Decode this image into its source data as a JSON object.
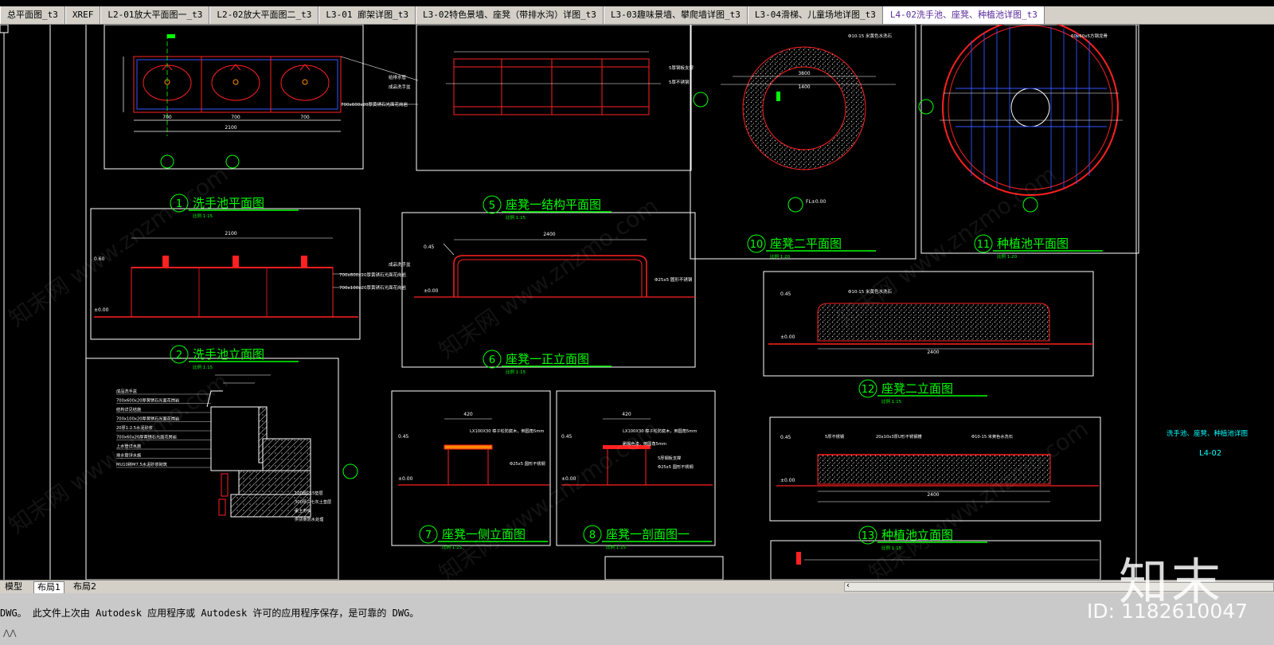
{
  "tabs": [
    {
      "label": "总平面图_t3",
      "active": false
    },
    {
      "label": "XREF",
      "active": false
    },
    {
      "label": "L2-01放大平面图一_t3",
      "active": false
    },
    {
      "label": "L2-02放大平面图二_t3",
      "active": false
    },
    {
      "label": "L3-01 廊架详图_t3",
      "active": false
    },
    {
      "label": "L3-02特色景墙、座凳（带排水沟）详图_t3",
      "active": false
    },
    {
      "label": "L3-03趣味景墙、攀爬墙详图_t3",
      "active": false
    },
    {
      "label": "L3-04滑梯、儿童场地详图_t3",
      "active": false
    },
    {
      "label": "L4-02洗手池、座凳、种植池详图_t3",
      "active": true
    }
  ],
  "drawing": {
    "details": [
      {
        "num": "1",
        "title": "洗手池平面图",
        "scale": "比例  1:15"
      },
      {
        "num": "2",
        "title": "洗手池立面图",
        "scale": "比例  1:15"
      },
      {
        "num": "5",
        "title": "座凳一结构平面图",
        "scale": "比例  1:15"
      },
      {
        "num": "6",
        "title": "座凳一正立面图",
        "scale": "比例  1:15"
      },
      {
        "num": "7",
        "title": "座凳一侧立面图",
        "scale": "比例  1:15"
      },
      {
        "num": "8",
        "title": "座凳一剖面图一",
        "scale": "比例  1:15"
      },
      {
        "num": "10",
        "title": "座凳二平面图",
        "scale": "比例  1:20"
      },
      {
        "num": "11",
        "title": "种植池平面图",
        "scale": "比例  1:20"
      },
      {
        "num": "12",
        "title": "座凳二立面图",
        "scale": "比例  1:15"
      },
      {
        "num": "13",
        "title": "种植池立面图",
        "scale": "比例  1:15"
      }
    ],
    "dims": {
      "basin_total": "2100",
      "basin_units": [
        "700",
        "700",
        "700"
      ],
      "seat_len": "2400",
      "seat_w": "420",
      "ring_dia": "3800",
      "ring_inner": "1400",
      "planter_len": "2400",
      "elev_045": "0.45",
      "elev_000": "±0.00",
      "elev_060": "0.60",
      "fl": "FL±0.00"
    },
    "annotations": {
      "basin_top": "成品洗手盆",
      "basin_tile1": "700x600x20厚黄锈石光面花岗岩",
      "basin_tile2": "700x100x20厚黄锈石光面花岗岩",
      "pipe": "给排水管",
      "steel_tube": "Φ25x5 圆形不锈钢",
      "steel_plate": "5厚钢板支撑",
      "wood": "LX100X30 樟子松防腐木，倒圆角5mm",
      "wood_paint": "刷褐色漆，倒圆角5mm",
      "stone_fill": "Φ10-15 米黄色水洗石",
      "stone_fill2": "Φ10-15 米黄色水洗石",
      "steel_edge": "5厚不锈钢",
      "weld": "20x10x3厚U形不锈钢槽",
      "planter_anchor": "60x60x5方钢龙骨"
    },
    "section_labels": [
      "成品洗手盆",
      "700x600x20厚黄锈石光面花岗岩",
      "结构详见结施",
      "700x100x20厚黄锈石光面花岗岩",
      "20厚1:2.5水泥砂浆",
      "700x60x20厚黄锈石光面花岗岩",
      "上水管详水施",
      "排水管详水施",
      "MU10砖M7.5水泥砂浆砌筑",
      "100厚C15垫层",
      "300厚三七灰土垫层",
      "素土夯实",
      "供货商防水处理"
    ],
    "sheet_title": "洗手池、座凳、种植池详图",
    "sheet_no": "L4-02"
  },
  "layout_tabs": [
    {
      "label": "模型",
      "active": false
    },
    {
      "label": "布局1",
      "active": true
    },
    {
      "label": "布局2",
      "active": false
    }
  ],
  "command_line": "DWG。   此文件上次由 Autodesk 应用程序或 Autodesk 许可的应用程序保存，是可靠的 DWG。",
  "watermark": {
    "logo": "知末",
    "id": "ID: 1182610047",
    "site": "知末网 www.znzmo.com"
  },
  "colors": {
    "accent_green": "#00ff00",
    "red": "#ff2020",
    "white": "#ffffff",
    "cyan": "#00ffff",
    "tab_active_text": "#5a2a9a"
  }
}
